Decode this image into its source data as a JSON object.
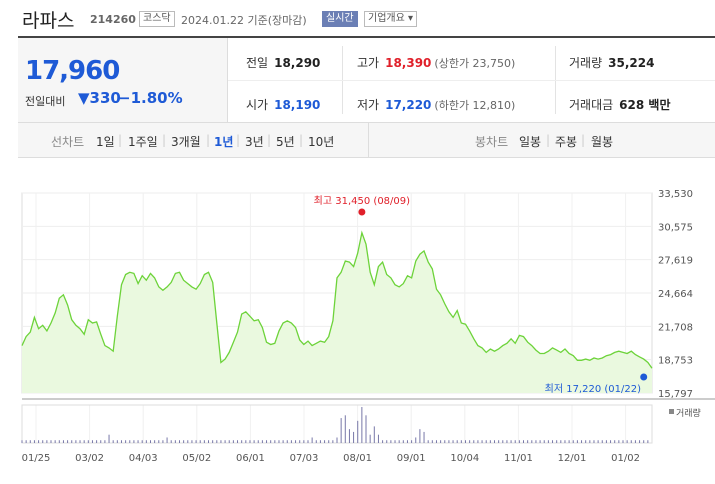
{
  "header": {
    "name": "라파스",
    "code": "214260",
    "market": "코스닥",
    "date": "2024.01.22 기준(장마감)",
    "realtime_label": "실시간",
    "overview_label": "기업개요 ▾"
  },
  "quote": {
    "price": "17,960",
    "change_label": "전일대비",
    "change_value": "▼330",
    "change_pct": "−1.80%",
    "prev_label": "전일",
    "prev": "18,290",
    "high_label": "고가",
    "high": "18,390",
    "upper_limit": "(상한가 23,750)",
    "volume_label": "거래량",
    "volume": "35,224",
    "open_label": "시가",
    "open": "18,190",
    "low_label": "저가",
    "low": "17,220",
    "lower_limit": "(하한가 12,810)",
    "value_label": "거래대금",
    "value": "628 백만"
  },
  "toolbar": {
    "line_label": "선차트",
    "periods": [
      "1일",
      "1주일",
      "3개월",
      "1년",
      "3년",
      "5년",
      "10년"
    ],
    "active_period": "1년",
    "candle_label": "봉차트",
    "candles": [
      "일봉",
      "주봉",
      "월봉"
    ]
  },
  "colors": {
    "line": "#6dd33a",
    "fill": "#eaf9df",
    "up": "#e0202a",
    "down": "#1e5ad6",
    "volume": "#7777a8"
  },
  "chart_data": {
    "type": "area",
    "title": "",
    "xlabel": "",
    "ylabel": "",
    "y_ticks": [
      "33,530",
      "30,575",
      "27,619",
      "24,664",
      "21,708",
      "18,753",
      "15,797"
    ],
    "ylim": [
      15797,
      33530
    ],
    "x_ticks": [
      "01/25",
      "03/02",
      "04/03",
      "05/02",
      "06/01",
      "07/03",
      "08/01",
      "09/01",
      "10/04",
      "11/01",
      "12/01",
      "01/02"
    ],
    "series": [
      {
        "name": "",
        "values": [
          20000,
          20800,
          21200,
          22500,
          21500,
          21800,
          21300,
          22000,
          22900,
          24200,
          24500,
          23600,
          22300,
          21800,
          21500,
          21000,
          22300,
          22000,
          22100,
          21000,
          20000,
          19800,
          19500,
          22600,
          25400,
          26300,
          26500,
          26400,
          25500,
          26200,
          25800,
          26400,
          26000,
          25200,
          24900,
          25200,
          25600,
          26400,
          26500,
          25800,
          25500,
          25200,
          25000,
          25500,
          26300,
          26500,
          25600,
          22000,
          18500,
          18800,
          19400,
          20300,
          21200,
          22800,
          23000,
          22600,
          22200,
          22300,
          21600,
          20300,
          20100,
          20200,
          21300,
          22000,
          22200,
          22000,
          21600,
          20500,
          20100,
          20400,
          20000,
          20200,
          20400,
          20300,
          20800,
          22200,
          26000,
          26500,
          27500,
          27400,
          27000,
          28200,
          30000,
          29000,
          26500,
          25400,
          27000,
          27400,
          26300,
          26000,
          25400,
          25200,
          25500,
          26200,
          26000,
          27500,
          28100,
          28400,
          27400,
          26800,
          25000,
          24500,
          23700,
          23000,
          22500,
          23100,
          22000,
          21900,
          21300,
          20600,
          20000,
          19800,
          19400,
          19700,
          19500,
          19700,
          20000,
          20200,
          20600,
          20200,
          20900,
          20800,
          20300,
          20000,
          19600,
          19300,
          19300,
          19500,
          19800,
          19600,
          19400,
          19700,
          19300,
          19100,
          18700,
          18700,
          18800,
          18700,
          18900,
          18800,
          18900,
          19100,
          19200,
          19400,
          19500,
          19400,
          19300,
          19500,
          19200,
          19000,
          18800,
          18500,
          18000
        ],
        "volume": [
          1,
          1,
          1,
          1,
          1,
          1,
          1,
          1,
          1,
          1,
          1,
          1,
          1,
          1,
          1,
          1,
          1,
          1,
          1,
          1,
          1,
          3,
          1,
          1,
          1,
          1,
          1,
          1,
          1,
          1,
          1,
          1,
          1,
          1,
          1,
          2,
          1,
          1,
          1,
          1,
          1,
          1,
          1,
          1,
          1,
          1,
          1,
          1,
          1,
          1,
          1,
          1,
          1,
          1,
          1,
          1,
          1,
          1,
          1,
          1,
          1,
          1,
          1,
          1,
          1,
          1,
          1,
          1,
          1,
          1,
          2,
          1,
          1,
          1,
          1,
          1,
          2,
          9,
          10,
          5,
          4,
          8,
          13,
          10,
          3,
          6,
          3,
          1,
          1,
          1,
          1,
          1,
          1,
          1,
          1,
          2,
          5,
          4,
          1,
          1,
          1,
          1,
          1,
          1,
          1,
          1,
          1,
          1,
          1,
          1,
          1,
          1,
          1,
          1,
          1,
          1,
          1,
          1,
          1,
          1,
          1,
          1,
          1,
          1,
          1,
          1,
          1,
          1,
          1,
          1,
          1,
          1,
          1,
          1,
          1,
          1,
          1,
          1,
          1,
          1,
          1,
          1,
          1,
          1,
          1,
          1,
          1,
          1,
          1,
          1,
          1,
          1
        ]
      }
    ],
    "max_annotation": {
      "label": "최고 31,450 (08/09)",
      "value": 31450,
      "index": 82
    },
    "min_annotation": {
      "label": "최저 17,220 (01/22)",
      "value": 17220,
      "index": 150
    },
    "volume_label": "거래량",
    "grid": true
  }
}
